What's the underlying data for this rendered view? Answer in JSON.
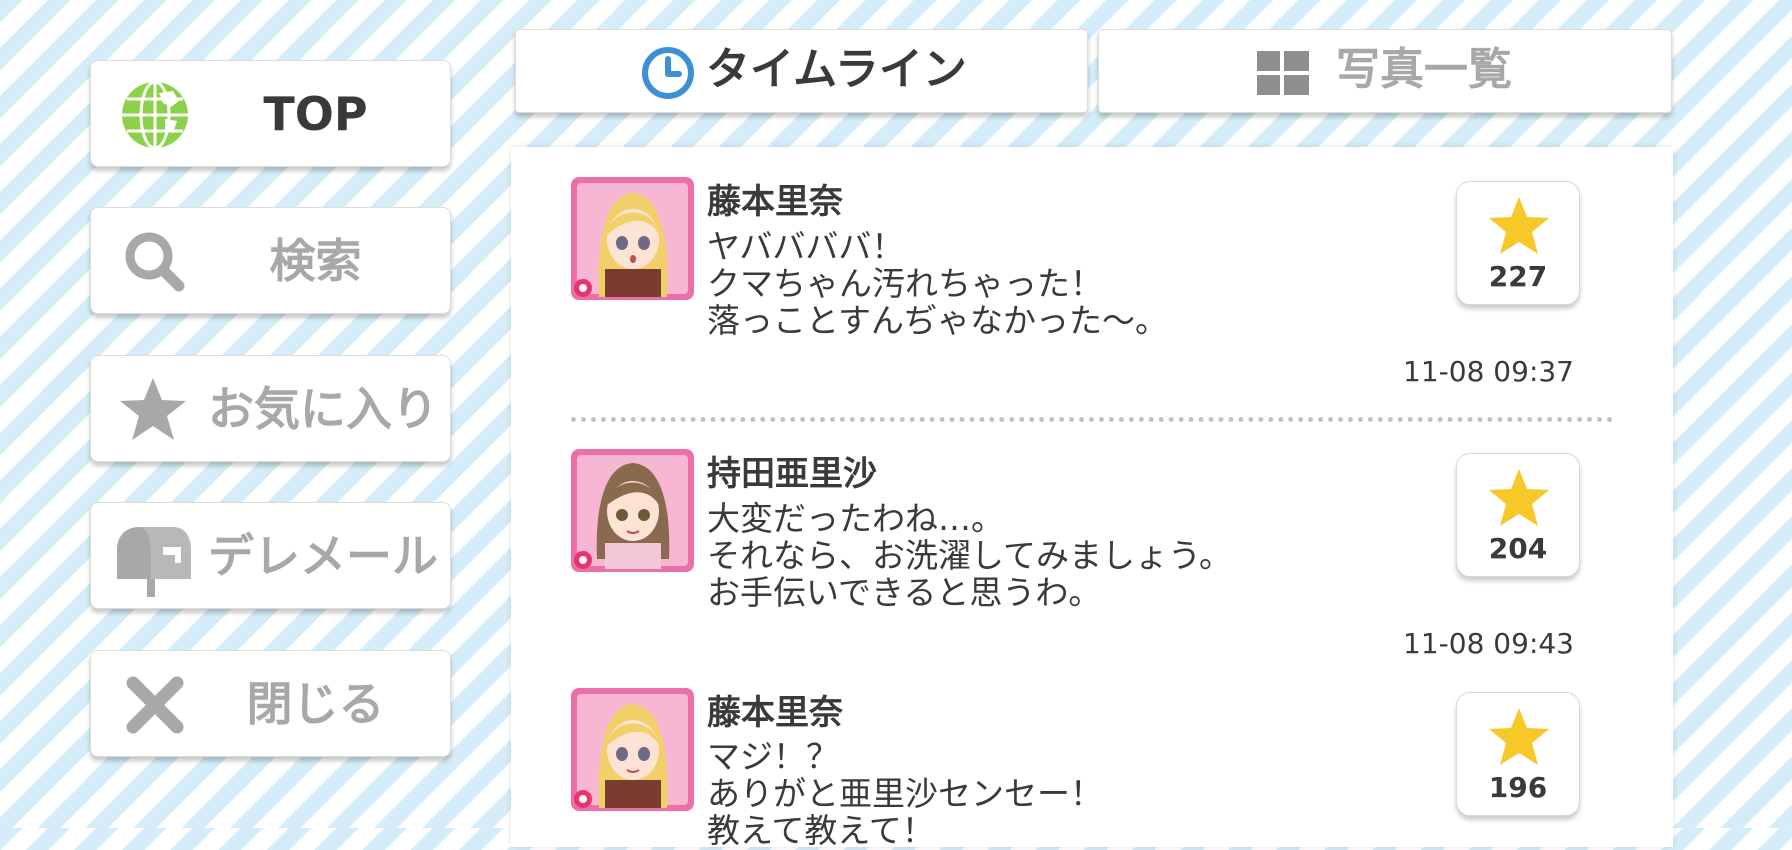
{
  "sidebar": {
    "items": [
      {
        "label": "TOP",
        "icon": "globe-icon",
        "active": true
      },
      {
        "label": "検索",
        "icon": "search-icon",
        "active": false
      },
      {
        "label": "お気に入り",
        "icon": "star-icon",
        "active": false
      },
      {
        "label": "デレメール",
        "icon": "mailbox-icon",
        "active": false
      },
      {
        "label": "閉じる",
        "icon": "close-icon",
        "active": false
      }
    ]
  },
  "tabs": [
    {
      "label": "タイムライン",
      "icon": "clock-icon",
      "active": true
    },
    {
      "label": "写真一覧",
      "icon": "grid-icon",
      "active": false
    }
  ],
  "posts": [
    {
      "name": "藤本里奈",
      "lines": [
        "ヤババババ！",
        "クマちゃん汚れちゃった！",
        "落っことすんぢゃなかった〜。"
      ],
      "likes": "227",
      "time": "11-08 09:37"
    },
    {
      "name": "持田亜里沙",
      "lines": [
        "大変だったわね…。",
        "それなら、お洗濯してみましょう。",
        "お手伝いできると思うわ。"
      ],
      "likes": "204",
      "time": "11-08 09:43"
    },
    {
      "name": "藤本里奈",
      "lines": [
        "マジ！？",
        "ありがと亜里沙センセー！",
        "教えて教えて！"
      ],
      "likes": "196",
      "time": ""
    }
  ],
  "colors": {
    "accent_globe": "#8bd14a",
    "clock_blue": "#3d8fd6",
    "star_yellow": "#f7c928",
    "avatar_frame": "#ec6fa8",
    "text_dark": "#3a3a3a",
    "inactive_gray": "#a8a8a8"
  }
}
